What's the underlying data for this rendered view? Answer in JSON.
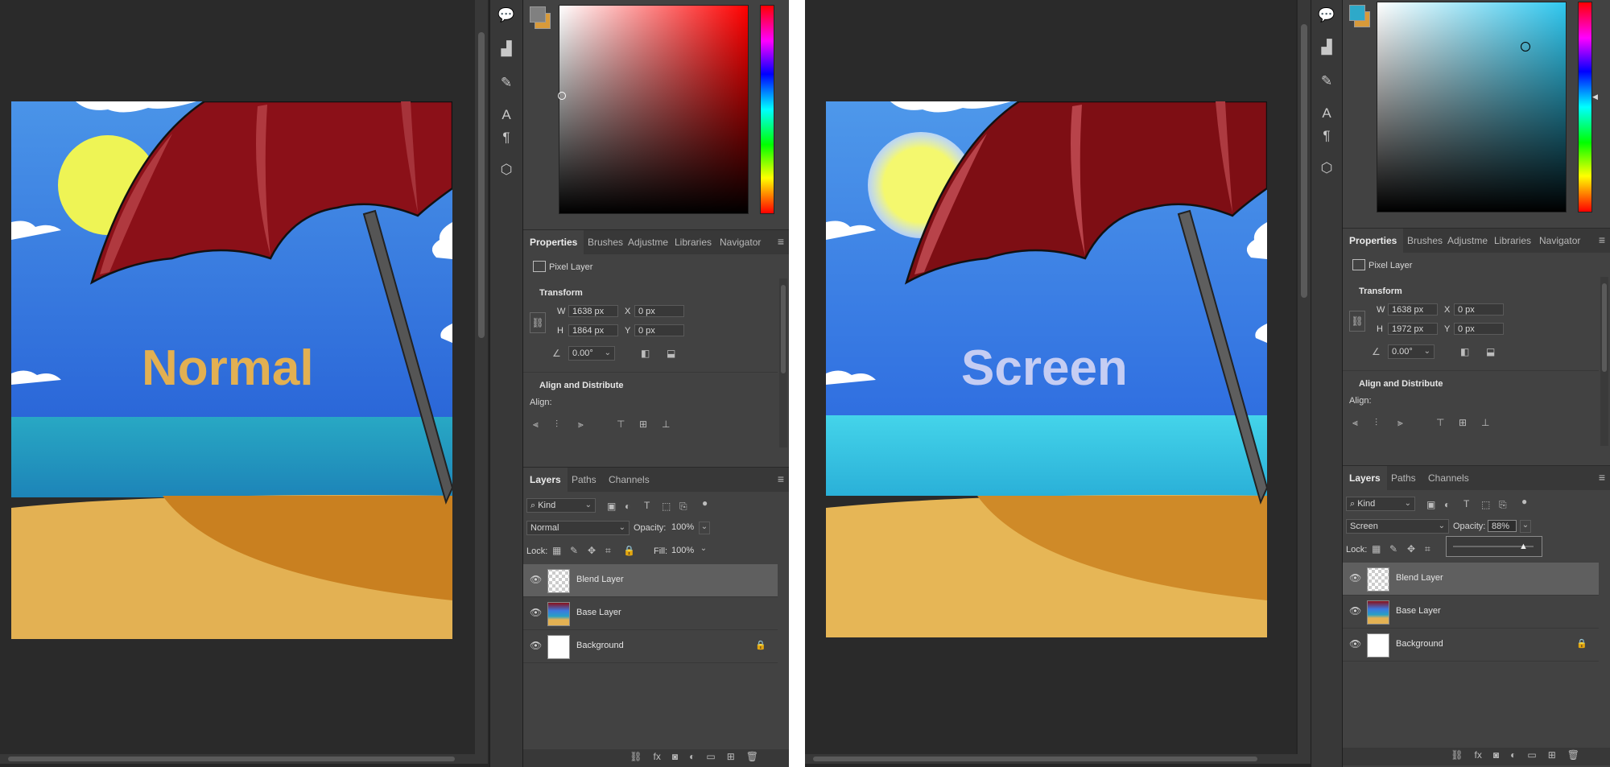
{
  "panes": [
    {
      "canvas_label": "Normal",
      "canvas_label_color": "#e2b052",
      "properties": {
        "tabs": [
          "Properties",
          "Brushes",
          "Adjustme",
          "Libraries",
          "Navigator"
        ],
        "layer_kind": "Pixel Layer",
        "transform_title": "Transform",
        "w_label": "W",
        "w_value": "1638 px",
        "h_label": "H",
        "h_value": "1864 px",
        "x_label": "X",
        "x_value": "0 px",
        "y_label": "Y",
        "y_value": "0 px",
        "angle_value": "0.00°",
        "align_title": "Align and Distribute",
        "align_label": "Align:"
      },
      "layers": {
        "tabs": [
          "Layers",
          "Paths",
          "Channels"
        ],
        "kind_filter": "Kind",
        "blend_mode": "Normal",
        "opacity_label": "Opacity:",
        "opacity_value": "100%",
        "lock_label": "Lock:",
        "fill_label": "Fill:",
        "fill_value": "100%",
        "items": [
          {
            "name": "Blend Layer",
            "selected": true
          },
          {
            "name": "Base Layer",
            "selected": false
          },
          {
            "name": "Background",
            "selected": false,
            "locked": true
          }
        ]
      },
      "colors": {
        "foreground": "#808080",
        "background": "#d89a3a",
        "hue": "#ff0000"
      }
    },
    {
      "canvas_label": "Screen",
      "canvas_label_color": "#c5cdf3",
      "properties": {
        "tabs": [
          "Properties",
          "Brushes",
          "Adjustme",
          "Libraries",
          "Navigator"
        ],
        "layer_kind": "Pixel Layer",
        "transform_title": "Transform",
        "w_label": "W",
        "w_value": "1638 px",
        "h_label": "H",
        "h_value": "1972 px",
        "x_label": "X",
        "x_value": "0 px",
        "y_label": "Y",
        "y_value": "0 px",
        "angle_value": "0.00°",
        "align_title": "Align and Distribute",
        "align_label": "Align:"
      },
      "layers": {
        "tabs": [
          "Layers",
          "Paths",
          "Channels"
        ],
        "kind_filter": "Kind",
        "blend_mode": "Screen",
        "opacity_label": "Opacity:",
        "opacity_value": "88%",
        "opacity_slider_fraction": 0.88,
        "lock_label": "Lock:",
        "items": [
          {
            "name": "Blend Layer",
            "selected": true
          },
          {
            "name": "Base Layer",
            "selected": false
          },
          {
            "name": "Background",
            "selected": false,
            "locked": true
          }
        ]
      },
      "colors": {
        "foreground": "#2ea9c9",
        "background": "#d89a3a",
        "hue": "#30c8f0"
      }
    }
  ],
  "icons": {
    "eye": "eye-icon",
    "lock": "lock-icon",
    "link": "chain-link-icon",
    "menu": "panel-menu-icon"
  }
}
